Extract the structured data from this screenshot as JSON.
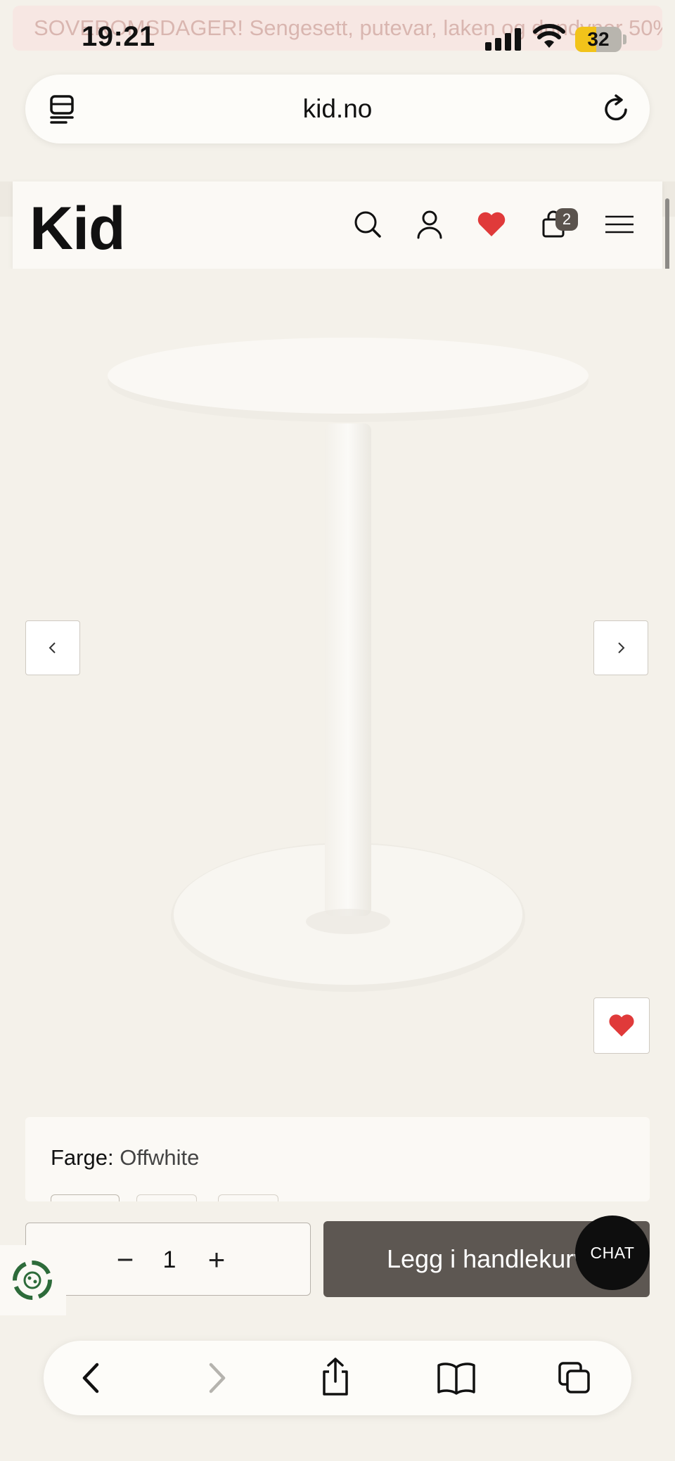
{
  "promo_banner": "SOVEROMSDAGER! Sengesett, putevar, laken og dundyner 50%",
  "status_bar": {
    "time": "19:21",
    "battery": "32"
  },
  "browser": {
    "url": "kid.no"
  },
  "site_header": {
    "logo": "Kid",
    "cart_count": "2"
  },
  "product": {
    "color_label": "Farge:",
    "color_value": "Offwhite"
  },
  "purchase": {
    "qty_minus": "−",
    "quantity": "1",
    "qty_plus": "+",
    "add_to_cart": "Legg i handlekurv",
    "chat": "CHAT"
  },
  "colors": {
    "accent_heart": "#e03a3a",
    "add_to_cart_bg": "#5d5752",
    "page_bg": "#f4f1ea"
  },
  "icons": [
    "tabs-icon",
    "reload-icon",
    "search-icon",
    "user-icon",
    "heart-icon",
    "bag-icon",
    "menu-icon",
    "chevron-left-icon",
    "chevron-right-icon",
    "recycle-icon",
    "back-icon",
    "forward-icon",
    "share-icon",
    "bookmarks-icon",
    "tabs-overview-icon"
  ]
}
